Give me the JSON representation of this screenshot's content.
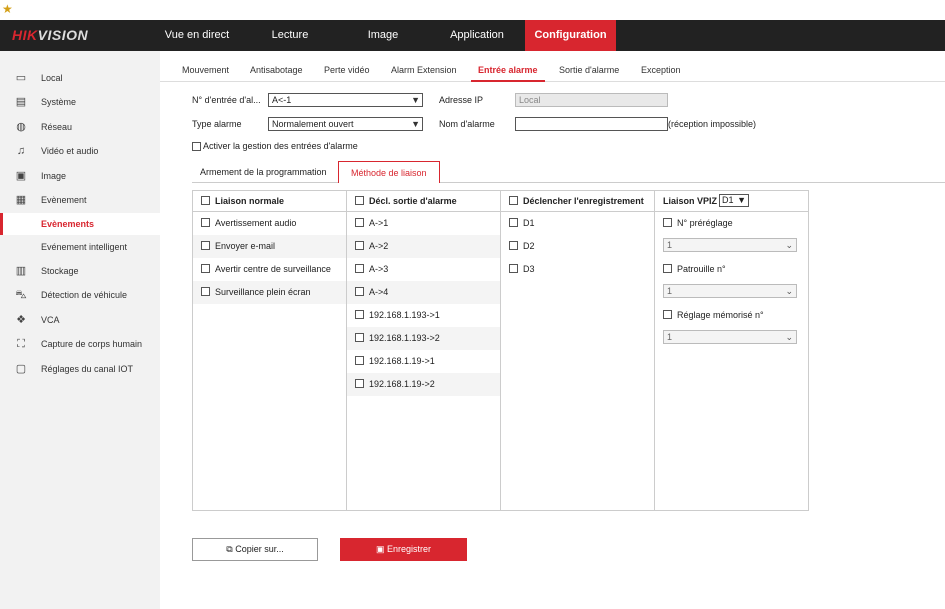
{
  "brand": {
    "part1": "HIK",
    "part2": "VISION"
  },
  "nav": [
    {
      "label": "Vue en direct",
      "active": false
    },
    {
      "label": "Lecture",
      "active": false
    },
    {
      "label": "Image",
      "active": false
    },
    {
      "label": "Application",
      "active": false
    },
    {
      "label": "Configuration",
      "active": true
    }
  ],
  "sidebar": [
    {
      "label": "Local",
      "icon": "monitor-icon"
    },
    {
      "label": "Système",
      "icon": "system-icon"
    },
    {
      "label": "Réseau",
      "icon": "globe-icon"
    },
    {
      "label": "Vidéo et audio",
      "icon": "video-audio-icon"
    },
    {
      "label": "Image",
      "icon": "image-icon"
    },
    {
      "label": "Evènement",
      "icon": "calendar-icon"
    },
    {
      "label": "Evènements",
      "icon": ""
    },
    {
      "label": "Evénement intelligent",
      "icon": ""
    },
    {
      "label": "Stockage",
      "icon": "storage-icon"
    },
    {
      "label": "Détection de véhicule",
      "icon": "vehicle-icon"
    },
    {
      "label": "VCA",
      "icon": "vca-icon"
    },
    {
      "label": "Capture de corps humain",
      "icon": "body-capture-icon"
    },
    {
      "label": "Réglages du canal IOT",
      "icon": "iot-icon"
    }
  ],
  "tabs": [
    "Mouvement",
    "Antisabotage",
    "Perte vidéo",
    "Alarm Extension",
    "Entrée alarme",
    "Sortie d'alarme",
    "Exception"
  ],
  "form": {
    "input_no_label": "N° d'entrée d'al...",
    "input_no_value": "A<-1",
    "ip_label": "Adresse IP",
    "ip_value": "Local",
    "type_label": "Type alarme",
    "type_value": "Normalement ouvert",
    "name_label": "Nom d'alarme",
    "name_value": "",
    "name_note": "(réception impossible)",
    "enable_label": "Activer la gestion des entrées d'alarme"
  },
  "subtabs": [
    "Armement de la programmation",
    "Méthode de liaison"
  ],
  "columns": {
    "normal": {
      "title": "Liaison normale",
      "items": [
        "Avertissement audio",
        "Envoyer e-mail",
        "Avertir centre de surveillance",
        "Surveillance plein écran"
      ]
    },
    "alarm_out": {
      "title": "Décl. sortie d'alarme",
      "items": [
        "A->1",
        "A->2",
        "A->3",
        "A->4",
        "192.168.1.193->1",
        "192.168.1.193->2",
        "192.168.1.19->1",
        "192.168.1.19->2"
      ]
    },
    "record": {
      "title": "Déclencher l'enregistrement",
      "items": [
        "D1",
        "D2",
        "D3"
      ]
    },
    "ptz": {
      "title": "Liaison VPIZ",
      "channel": "D1",
      "preset_label": "N° préréglage",
      "preset_value": "1",
      "patrol_label": "Patrouille n°",
      "patrol_value": "1",
      "pattern_label": "Réglage mémorisé n°",
      "pattern_value": "1"
    }
  },
  "buttons": {
    "copy": "Copier sur...",
    "save": "Enregistrer"
  }
}
